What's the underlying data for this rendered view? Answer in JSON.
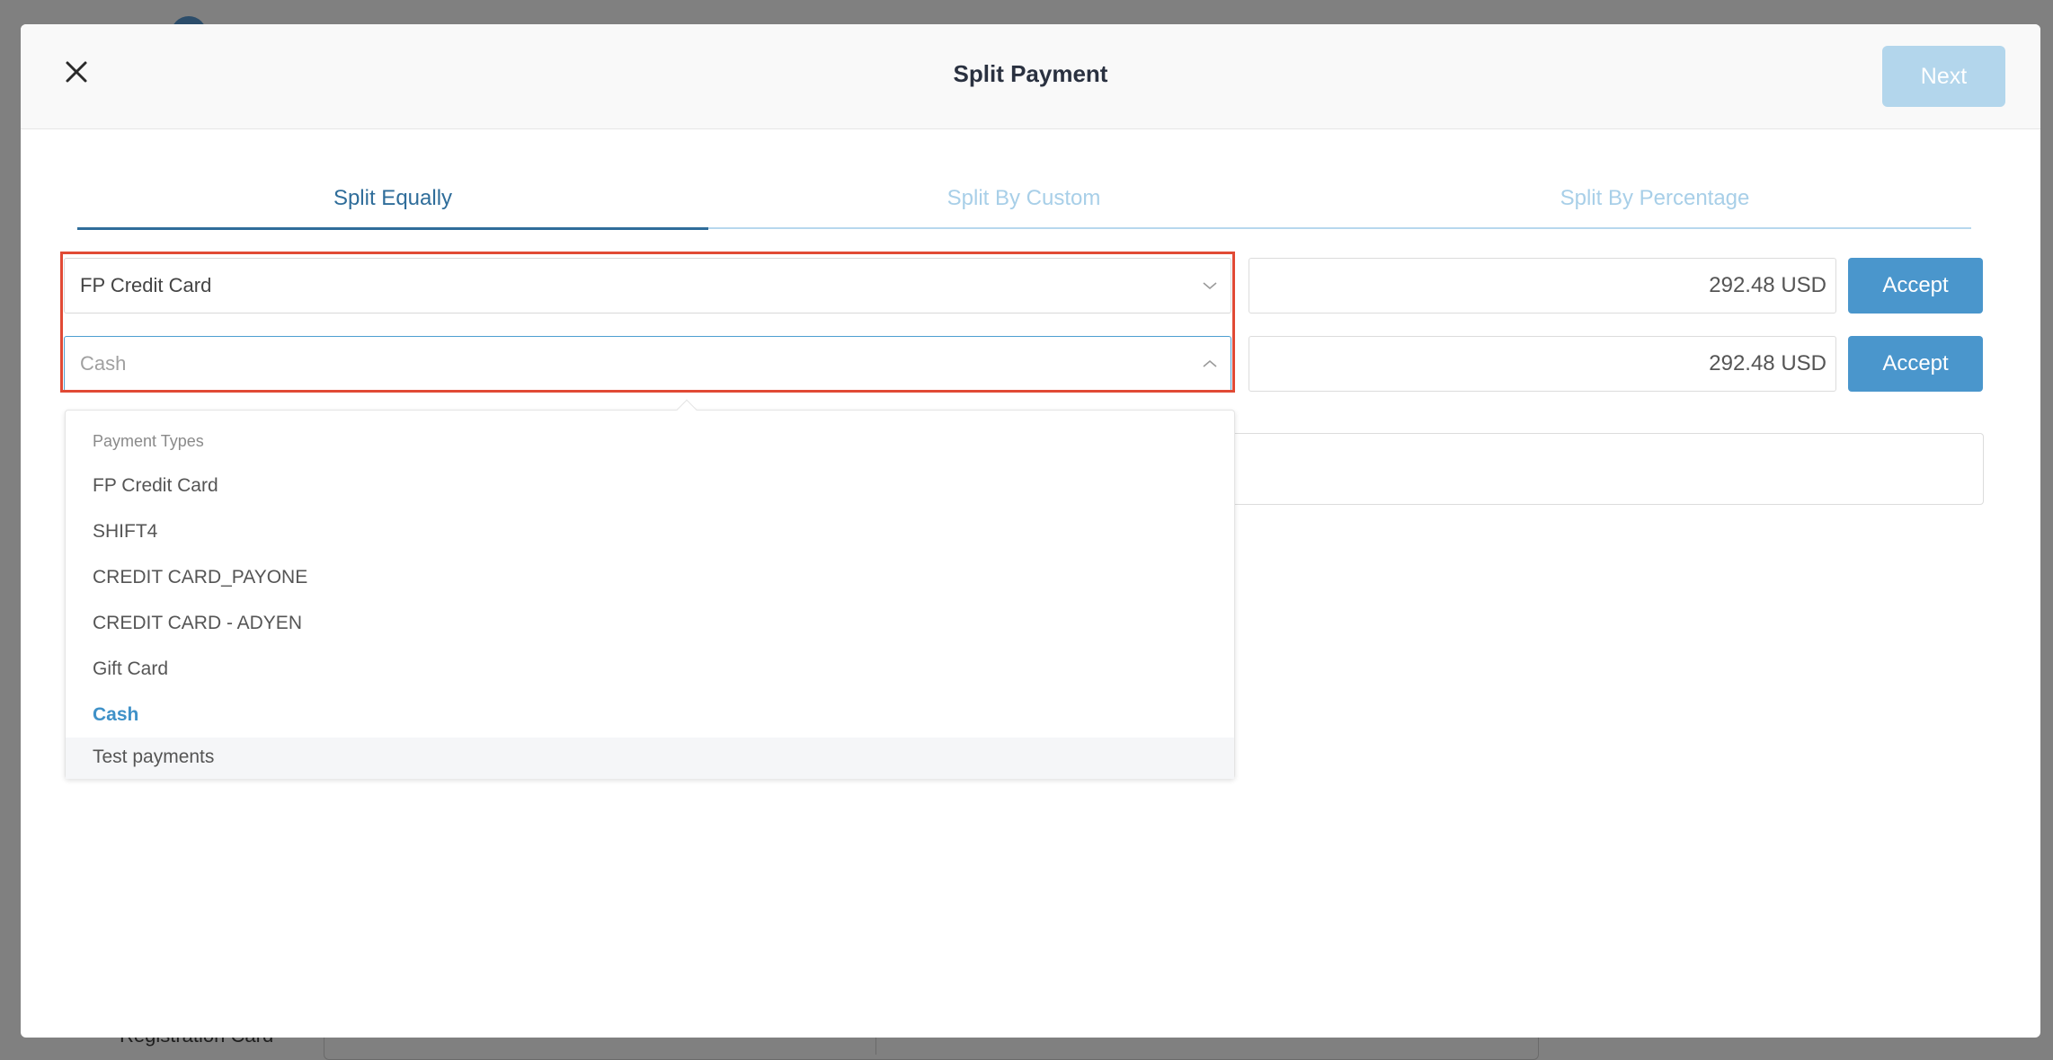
{
  "modal": {
    "title": "Split Payment",
    "next_label": "Next"
  },
  "tabs": [
    {
      "label": "Split Equally",
      "active": true
    },
    {
      "label": "Split By Custom",
      "active": false
    },
    {
      "label": "Split By Percentage",
      "active": false
    }
  ],
  "rows": [
    {
      "payment_type": "FP Credit Card",
      "amount": "292.48 USD",
      "accept_label": "Accept"
    },
    {
      "payment_type_placeholder": "Cash",
      "amount": "292.48 USD",
      "accept_label": "Accept"
    }
  ],
  "dropdown": {
    "group_label": "Payment Types",
    "options": [
      "FP Credit Card",
      "SHIFT4",
      "CREDIT CARD_PAYONE",
      "CREDIT CARD - ADYEN",
      "Gift Card",
      "Cash",
      "Test payments"
    ],
    "selected": "Cash",
    "hovered": "Test payments"
  },
  "background": {
    "label": "Registration Card"
  },
  "colors": {
    "accent": "#4a96cc",
    "tab_active": "#2f6d9a",
    "highlight": "#e14a35"
  }
}
